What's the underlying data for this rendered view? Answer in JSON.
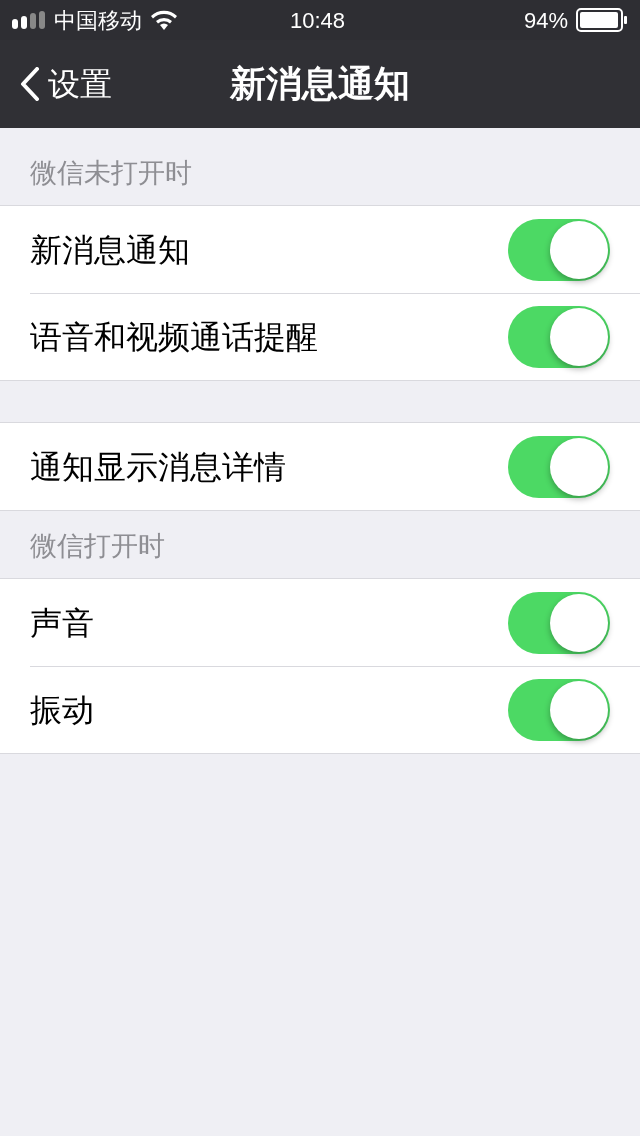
{
  "status_bar": {
    "carrier": "中国移动",
    "time": "10:48",
    "battery": "94%"
  },
  "nav": {
    "back": "设置",
    "title": "新消息通知"
  },
  "sections": [
    {
      "header": "微信未打开时",
      "rows": [
        {
          "label": "新消息通知",
          "on": true
        },
        {
          "label": "语音和视频通话提醒",
          "on": true
        }
      ]
    },
    {
      "rows": [
        {
          "label": "通知显示消息详情",
          "on": true
        }
      ]
    },
    {
      "header": "微信打开时",
      "rows": [
        {
          "label": "声音",
          "on": true
        },
        {
          "label": "振动",
          "on": true
        }
      ]
    }
  ]
}
